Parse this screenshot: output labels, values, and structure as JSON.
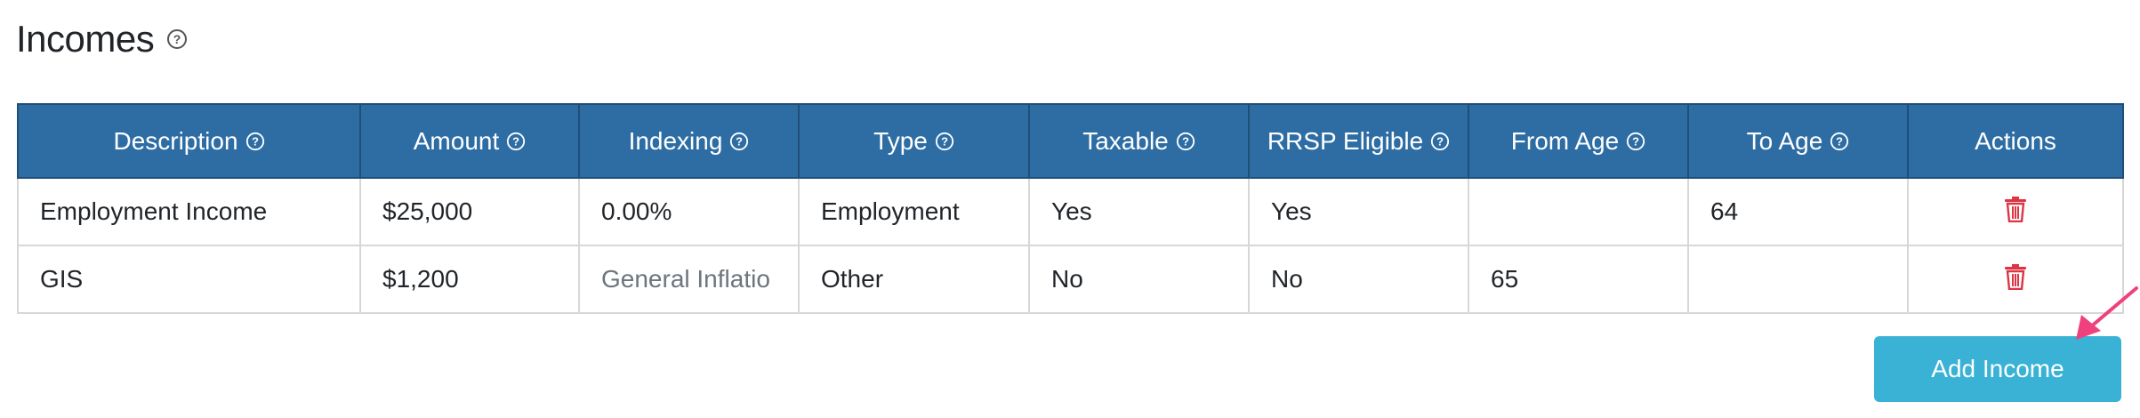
{
  "section": {
    "title": "Incomes",
    "title_help_icon": "question-circle-icon"
  },
  "table": {
    "columns": [
      {
        "label": "Description",
        "help": true
      },
      {
        "label": "Amount",
        "help": true
      },
      {
        "label": "Indexing",
        "help": true
      },
      {
        "label": "Type",
        "help": true
      },
      {
        "label": "Taxable",
        "help": true
      },
      {
        "label": "RRSP Eligible",
        "help": true
      },
      {
        "label": "From Age",
        "help": true
      },
      {
        "label": "To Age",
        "help": true
      },
      {
        "label": "Actions",
        "help": false
      }
    ],
    "rows": [
      {
        "description": "Employment Income",
        "amount": "$25,000",
        "indexing": "0.00%",
        "type": "Employment",
        "taxable": "Yes",
        "rrsp_eligible": "Yes",
        "from_age": "",
        "to_age": "64",
        "action_icon": "trash-icon"
      },
      {
        "description": "GIS",
        "amount": "$1,200",
        "indexing": "General Inflatio",
        "type": "Other",
        "taxable": "No",
        "rrsp_eligible": "No",
        "from_age": "65",
        "to_age": "",
        "action_icon": "trash-icon"
      }
    ]
  },
  "add_button": {
    "label": "Add Income"
  },
  "colors": {
    "header_bg": "#2e6da4",
    "button_bg": "#39b2d6",
    "delete_icon": "#dc3545",
    "annotation_arrow": "#f0407e"
  }
}
